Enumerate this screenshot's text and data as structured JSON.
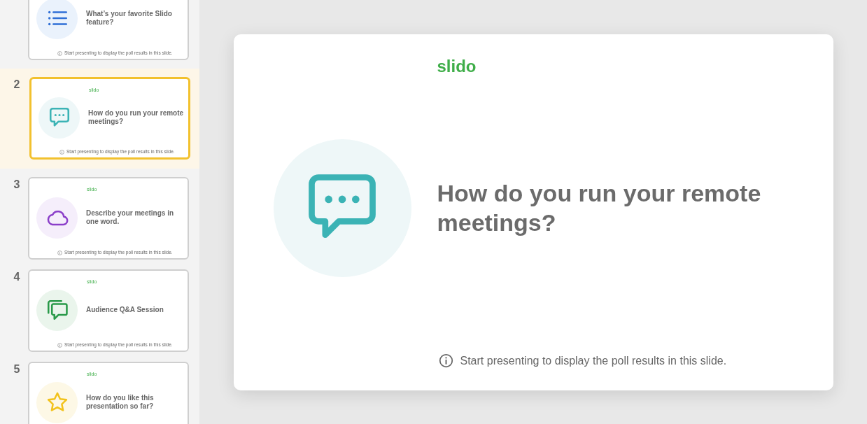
{
  "sidebar": {
    "slides": [
      {
        "kind": "multiple-choice",
        "selected": false,
        "title": "What’s your favorite Slido feature?",
        "note": "Start presenting to display the poll results in this slide."
      },
      {
        "number": "2",
        "kind": "open-text",
        "selected": true,
        "logo": "slido",
        "title": "How do you run your remote meetings?",
        "note": "Start presenting to display the poll results in this slide."
      },
      {
        "number": "3",
        "kind": "word-cloud",
        "selected": false,
        "logo": "slido",
        "title": "Describe your meetings in one word.",
        "note": "Start presenting to display the poll results in this slide."
      },
      {
        "number": "4",
        "kind": "qa",
        "selected": false,
        "logo": "slido",
        "title": "Audience Q&A Session",
        "note": "Start presenting to display the poll results in this slide."
      },
      {
        "number": "5",
        "kind": "rating",
        "selected": false,
        "logo": "slido",
        "title": "How do you like this presentation so far?"
      }
    ]
  },
  "slide": {
    "kind": "open-text",
    "logo": "slido",
    "title": "How do you run your remote meetings?",
    "note": "Start presenting to display the poll results in this slide."
  }
}
